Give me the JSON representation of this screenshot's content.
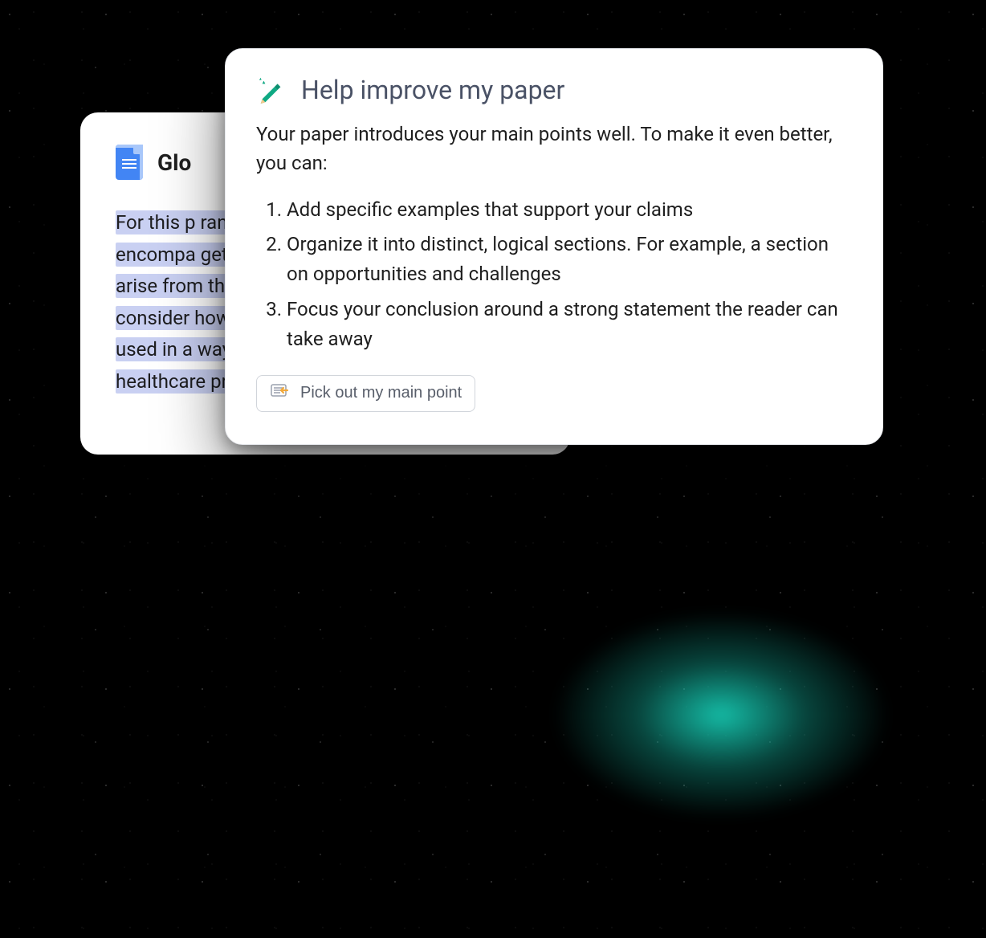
{
  "document": {
    "title": "Glo",
    "body_text": "For this p range of software to autom hospitals encompa getting d to the ma hospitals analyze t arise from the use of technology in this field, and consider how we can ensure that technology is used in a way that benefits patients and healthcare providers alike."
  },
  "assistant": {
    "title": "Help improve my paper",
    "intro": "Your paper introduces your main points well. To make it even better, you can:",
    "suggestions": [
      "Add specific examples that support your claims",
      "Organize it into distinct, logical sections. For example, a section on opportunities and challenges",
      "Focus your conclusion around a strong statement the reader can take away"
    ],
    "chip_label": "Pick out my main point"
  },
  "icons": {
    "docs": "google-docs-icon",
    "pencil": "sparkle-pencil-icon",
    "highlighter": "highlighter-icon",
    "grammarly": "grammarly-icon"
  },
  "colors": {
    "highlight": "#c9d0f2",
    "accent_teal": "#0b7c6b",
    "assist_title": "#4a5266"
  }
}
